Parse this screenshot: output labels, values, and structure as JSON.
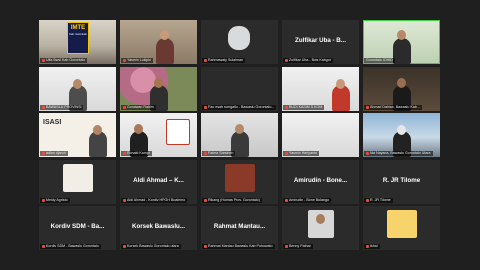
{
  "app": "Zoom Meeting - Gallery View",
  "tiles": [
    {
      "id": "t1",
      "name": "Ulfa Bwsl Kab Gorontalo",
      "poster_title": "IMTE",
      "poster_sub": "Kab. Gorontalo"
    },
    {
      "id": "t2",
      "name": "Yasmin Lukipin"
    },
    {
      "id": "t3",
      "name": "Rahmawaty Sulaiman"
    },
    {
      "id": "t4",
      "big": "Zulfikar Uba - B...",
      "name": "Zulfikar Uba - Bws Kabgor"
    },
    {
      "id": "t5",
      "name": "Gorontalo IOHID",
      "active": true
    },
    {
      "id": "t6",
      "name": "BAWASLU PROVINSI"
    },
    {
      "id": "t7",
      "name": "Gunawan Rahim"
    },
    {
      "id": "t8",
      "name": "Fau esah rumgailu - Bawaslu Gorontalo..."
    },
    {
      "id": "t9",
      "name": "BUDI KASIM S.KOM"
    },
    {
      "id": "t10",
      "name": "Ahmad Dahlan, Bawaslu Kab..."
    },
    {
      "id": "t11",
      "name": "adlan djaruh",
      "slide_text": "ISASI"
    },
    {
      "id": "t12",
      "name": "Ronald Kampi"
    },
    {
      "id": "t13",
      "name": "Fatma Sarsinen"
    },
    {
      "id": "t14",
      "name": "Yasmin Hariyanto"
    },
    {
      "id": "t15",
      "name": "Ida Nayana, Bawaslu Gorontalo Utara"
    },
    {
      "id": "t16",
      "name": "Meidy Agristo"
    },
    {
      "id": "t17",
      "big": "Aldi Ahmad – K...",
      "name": "Aldi Ahmad - Kordiv HPGH Boalemo"
    },
    {
      "id": "t18",
      "name": "Rikang (Humas Prov. Gorontalo)"
    },
    {
      "id": "t19",
      "big": "Amirudin - Bone...",
      "name": "Amirudin - Bone Bolango"
    },
    {
      "id": "t20",
      "big": "R. JR Tilome",
      "name": "R. JR Tilome"
    },
    {
      "id": "t21",
      "big": "Kordiv SDM - Ba...",
      "name": "Kordiv SDM - Bawaslu Gorontalo"
    },
    {
      "id": "t22",
      "big": "Korsek Bawaslu...",
      "name": "Korsek Bawaslu Gorontalo utara"
    },
    {
      "id": "t23",
      "big": "Rahmat Mantau...",
      "name": "Rahmat Mantau Bawaslu Kab Pohuwato"
    },
    {
      "id": "t24",
      "name": "Benny Pathar"
    },
    {
      "id": "t25",
      "name": "Ikhal"
    }
  ]
}
